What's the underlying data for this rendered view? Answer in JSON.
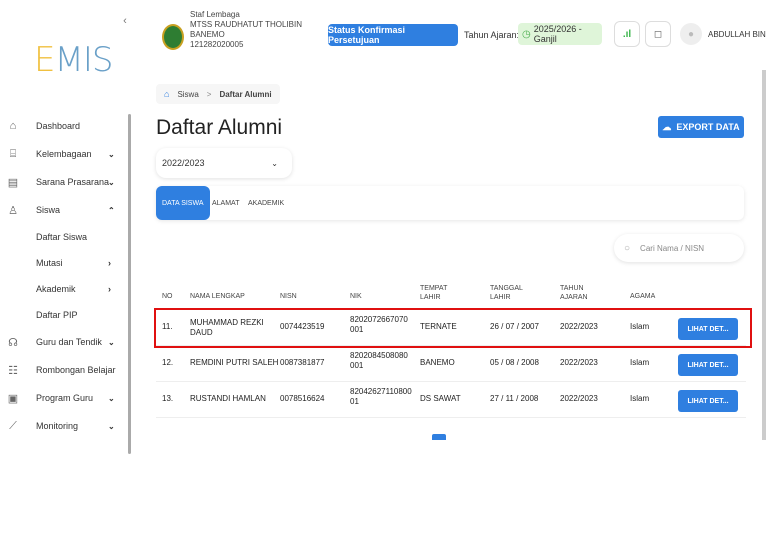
{
  "app": {
    "logo": "EMIS"
  },
  "sidebar": {
    "items": [
      {
        "label": "Dashboard",
        "icon": "home-icon",
        "chevron": ""
      },
      {
        "label": "Kelembagaan",
        "icon": "institution-icon",
        "chevron": "⌄"
      },
      {
        "label": "Sarana Prasarana",
        "icon": "building-icon",
        "chevron": "⌄"
      },
      {
        "label": "Siswa",
        "icon": "user-icon",
        "chevron": "⌃"
      }
    ],
    "siswa_sub": [
      {
        "label": "Daftar Siswa",
        "chevron": ""
      },
      {
        "label": "Mutasi",
        "chevron": "›"
      },
      {
        "label": "Akademik",
        "chevron": "›"
      },
      {
        "label": "Daftar PIP",
        "chevron": ""
      }
    ],
    "items_after": [
      {
        "label": "Guru dan Tendik",
        "icon": "teachers-icon",
        "chevron": "⌄"
      },
      {
        "label": "Rombongan Belajar",
        "icon": "group-icon",
        "chevron": ""
      },
      {
        "label": "Program Guru",
        "icon": "document-icon",
        "chevron": "⌄"
      },
      {
        "label": "Monitoring",
        "icon": "chart-icon",
        "chevron": "⌄"
      }
    ]
  },
  "header": {
    "staff_label": "Staf Lembaga",
    "school_name_1": "MTSS RAUDHATUT THOLIBIN",
    "school_name_2": "BANEMO",
    "school_id": "121282020005",
    "status_button": "Status Konfirmasi Persetujuan",
    "tahun_ajaran_label": "Tahun Ajaran:",
    "tahun_ajaran_value": "2025/2026 - Ganjil",
    "username": "ABDULLAH BIN BA"
  },
  "breadcrumb": {
    "parent": "Siswa",
    "current": "Daftar Alumni"
  },
  "page": {
    "title": "Daftar Alumni",
    "export_label": "EXPORT DATA",
    "year_selected": "2022/2023"
  },
  "tabs": [
    {
      "label": "DATA SISWA",
      "active": true
    },
    {
      "label": "ALAMAT",
      "active": false
    },
    {
      "label": "AKADEMIK",
      "active": false
    }
  ],
  "search": {
    "placeholder": "Cari Nama / NISN"
  },
  "table": {
    "headers": {
      "no": "NO",
      "nama": "NAMA LENGKAP",
      "nisn": "NISN",
      "nik": "NIK",
      "tempat_1": "TEMPAT",
      "tempat_2": "LAHIR",
      "tanggal_1": "TANGGAL",
      "tanggal_2": "LAHIR",
      "tahun_1": "TAHUN",
      "tahun_2": "AJARAN",
      "agama": "AGAMA"
    },
    "rows": [
      {
        "no": "11.",
        "nama_1": "MUHAMMAD REZKI",
        "nama_2": "DAUD",
        "nisn": "0074423519",
        "nik": "8202072667070001",
        "tempat": "TERNATE",
        "tanggal": "26 / 07 / 2007",
        "tahun": "2022/2023",
        "agama": "Islam",
        "action": "LIHAT DET..."
      },
      {
        "no": "12.",
        "nama_1": "REMDINI PUTRI SALEH",
        "nama_2": "",
        "nisn": "0087381877",
        "nik": "8202084508080001",
        "tempat": "BANEMO",
        "tanggal": "05 / 08 / 2008",
        "tahun": "2022/2023",
        "agama": "Islam",
        "action": "LIHAT DET..."
      },
      {
        "no": "13.",
        "nama_1": "RUSTANDI HAMLAN",
        "nama_2": "",
        "nisn": "0078516624",
        "nik": "8204262711080001",
        "tempat": "DS SAWAT",
        "tanggal": "27 / 11 / 2008",
        "tahun": "2022/2023",
        "agama": "Islam",
        "action": "LIHAT DET..."
      }
    ]
  },
  "colors": {
    "primary": "#2f7fe0",
    "highlight": "#e01010",
    "badge_bg": "#dff5d9"
  }
}
